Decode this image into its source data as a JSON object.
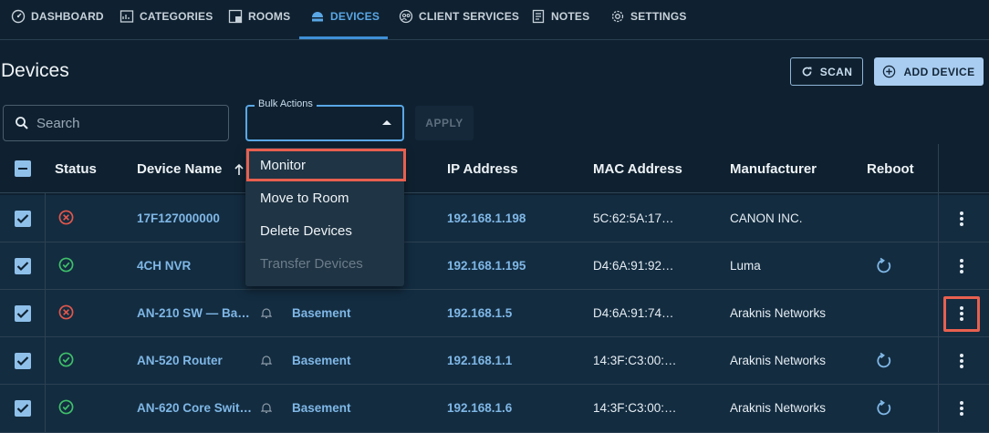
{
  "nav": [
    {
      "label": "DASHBOARD",
      "icon": "dashboard-icon"
    },
    {
      "label": "CATEGORIES",
      "icon": "categories-icon"
    },
    {
      "label": "ROOMS",
      "icon": "rooms-icon"
    },
    {
      "label": "DEVICES",
      "icon": "devices-icon",
      "active": true
    },
    {
      "label": "CLIENT SERVICES",
      "icon": "client-services-icon"
    },
    {
      "label": "NOTES",
      "icon": "notes-icon"
    },
    {
      "label": "SETTINGS",
      "icon": "settings-icon"
    }
  ],
  "page": {
    "title": "Devices"
  },
  "toolbar": {
    "scan_label": "SCAN",
    "add_label": "ADD DEVICE",
    "search_placeholder": "Search",
    "bulk_label": "Bulk Actions",
    "apply_label": "APPLY"
  },
  "bulk_menu": [
    {
      "label": "Monitor"
    },
    {
      "label": "Move to Room"
    },
    {
      "label": "Delete Devices"
    },
    {
      "label": "Transfer Devices",
      "disabled": true
    }
  ],
  "table": {
    "columns": [
      "Status",
      "Device Name",
      "IP Address",
      "MAC Address",
      "Manufacturer",
      "Reboot"
    ],
    "rows": [
      {
        "status": "offline",
        "name": "17F127000000",
        "room": "",
        "ip": "192.168.1.198",
        "mac": "5C:62:5A:17…",
        "manufacturer": "CANON INC.",
        "reboot": false
      },
      {
        "status": "online",
        "name": "4CH NVR",
        "room": "",
        "ip": "192.168.1.195",
        "mac": "D4:6A:91:92…",
        "manufacturer": "Luma",
        "reboot": true
      },
      {
        "status": "offline",
        "name": "AN-210 SW — Ba…",
        "room": "Basement",
        "ip": "192.168.1.5",
        "mac": "D4:6A:91:74…",
        "manufacturer": "Araknis Networks",
        "reboot": false
      },
      {
        "status": "online",
        "name": "AN-520 Router",
        "room": "Basement",
        "ip": "192.168.1.1",
        "mac": "14:3F:C3:00:…",
        "manufacturer": "Araknis Networks",
        "reboot": true
      },
      {
        "status": "online",
        "name": "AN-620 Core Swit…",
        "room": "Basement",
        "ip": "192.168.1.6",
        "mac": "14:3F:C3:00:…",
        "manufacturer": "Araknis Networks",
        "reboot": true
      }
    ]
  },
  "colors": {
    "accent": "#5aa7e6",
    "highlight": "#e8604f",
    "online": "#3fbf6a",
    "offline": "#e2574c"
  }
}
